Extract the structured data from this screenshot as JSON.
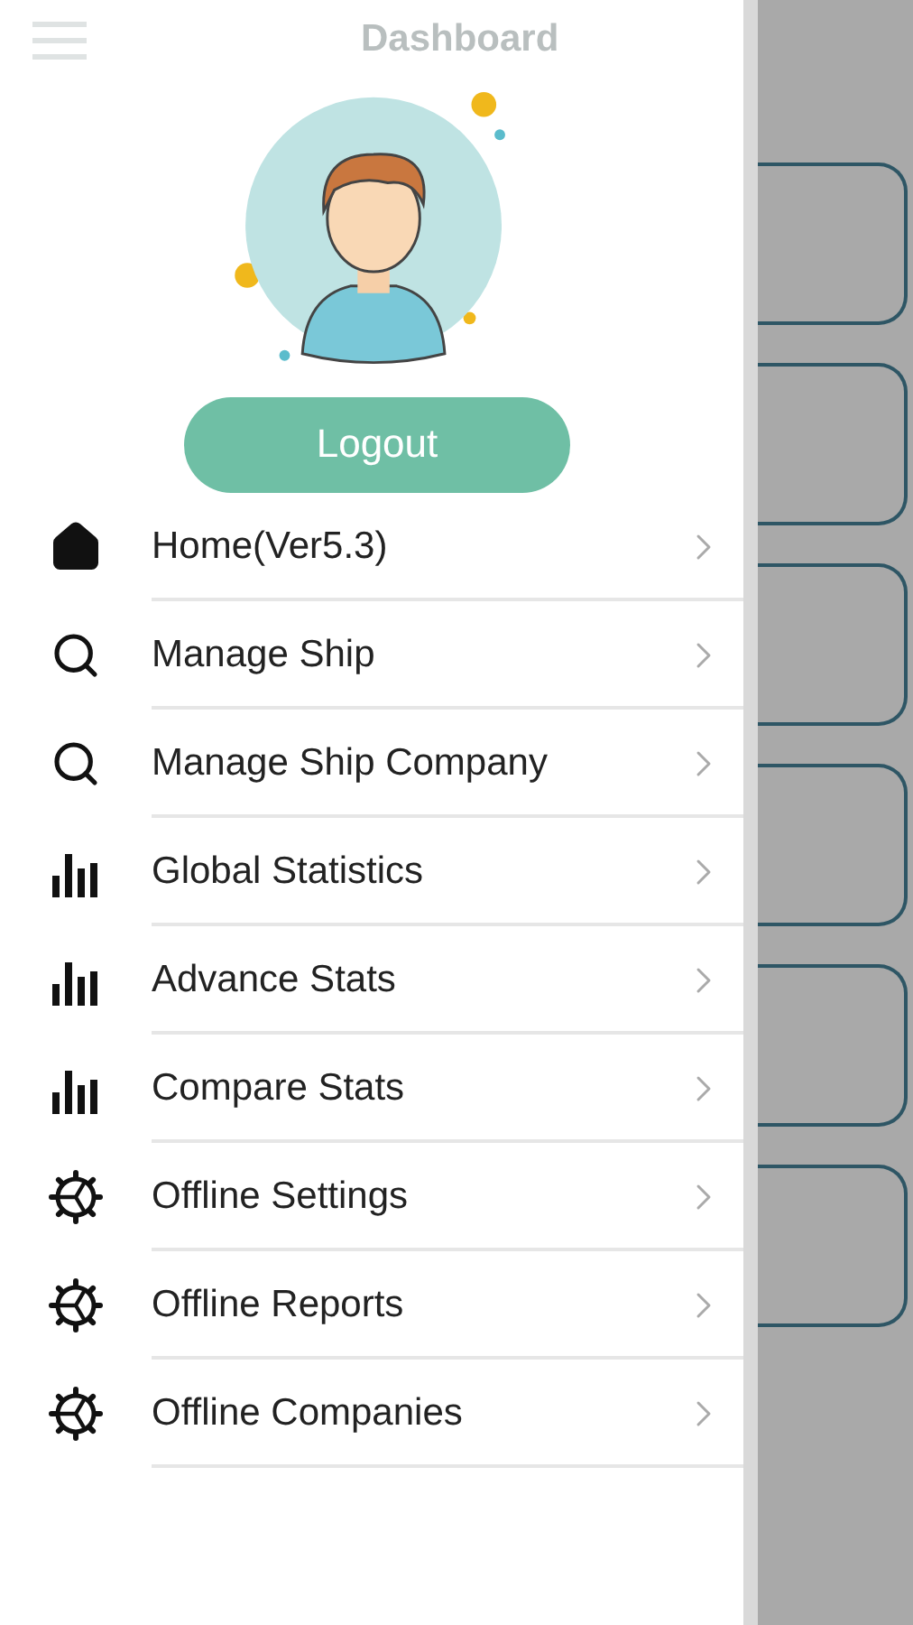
{
  "header": {
    "title": "Dashboard"
  },
  "drawer": {
    "logout": "Logout",
    "items": [
      {
        "kind": "home",
        "label": "Home(Ver5.3)"
      },
      {
        "kind": "search",
        "label": "Manage Ship"
      },
      {
        "kind": "search",
        "label": "Manage Ship Company"
      },
      {
        "kind": "chart",
        "label": "Global Statistics"
      },
      {
        "kind": "chart",
        "label": "Advance Stats"
      },
      {
        "kind": "chart",
        "label": "Compare Stats"
      },
      {
        "kind": "gear",
        "label": "Offline Settings"
      },
      {
        "kind": "gear",
        "label": "Offline Reports"
      },
      {
        "kind": "gear",
        "label": "Offline Companies"
      }
    ]
  }
}
